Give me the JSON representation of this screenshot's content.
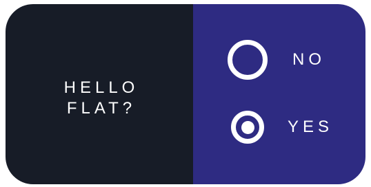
{
  "question": {
    "line1": "HELLO",
    "line2": "FLAT?"
  },
  "options": [
    {
      "label": "NO",
      "selected": false
    },
    {
      "label": "YES",
      "selected": true
    }
  ],
  "colors": {
    "left_panel": "#171c27",
    "right_panel": "#2e2b82",
    "foreground": "#ffffff"
  }
}
